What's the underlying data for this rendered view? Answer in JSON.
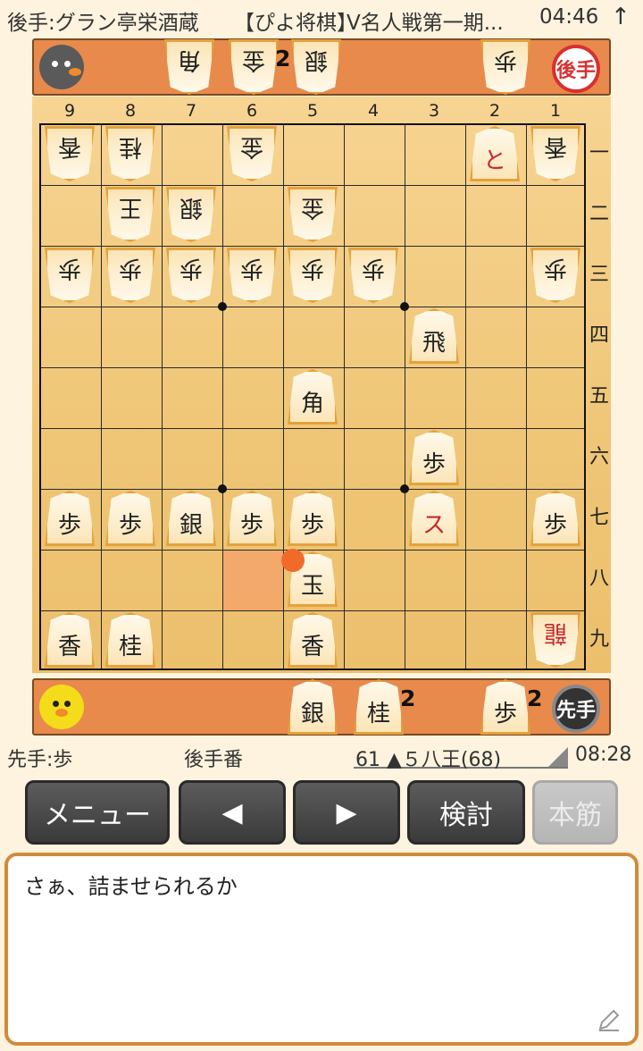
{
  "top_bar": {
    "opponent": "後手:グラン亭栄酒蔵",
    "app_name": "【ぴよ将棋】",
    "event": "V名人戦第一期...",
    "time": "04:46",
    "arrow": "↑"
  },
  "gote_hand": {
    "badge": "後手",
    "pieces": [
      {
        "label": "角",
        "count": ""
      },
      {
        "label": "金",
        "count": "2"
      },
      {
        "label": "銀",
        "count": ""
      },
      {
        "label": "歩",
        "count": ""
      }
    ]
  },
  "sente_hand": {
    "badge": "先手",
    "pieces": [
      {
        "label": "銀",
        "count": ""
      },
      {
        "label": "桂",
        "count": "2"
      },
      {
        "label": "歩",
        "count": "2"
      }
    ]
  },
  "board": {
    "files": [
      "9",
      "8",
      "7",
      "6",
      "5",
      "4",
      "3",
      "2",
      "1"
    ],
    "ranks": [
      "一",
      "二",
      "三",
      "四",
      "五",
      "六",
      "七",
      "八",
      "九"
    ],
    "pieces": [
      {
        "file": 9,
        "rank": 1,
        "label": "香",
        "owner": "gote"
      },
      {
        "file": 8,
        "rank": 1,
        "label": "桂",
        "owner": "gote"
      },
      {
        "file": 6,
        "rank": 1,
        "label": "金",
        "owner": "gote"
      },
      {
        "file": 2,
        "rank": 1,
        "label": "と",
        "owner": "sente",
        "promoted": true
      },
      {
        "file": 1,
        "rank": 1,
        "label": "香",
        "owner": "gote"
      },
      {
        "file": 8,
        "rank": 2,
        "label": "王",
        "owner": "gote"
      },
      {
        "file": 7,
        "rank": 2,
        "label": "銀",
        "owner": "gote"
      },
      {
        "file": 5,
        "rank": 2,
        "label": "金",
        "owner": "gote"
      },
      {
        "file": 9,
        "rank": 3,
        "label": "歩",
        "owner": "gote"
      },
      {
        "file": 8,
        "rank": 3,
        "label": "歩",
        "owner": "gote"
      },
      {
        "file": 7,
        "rank": 3,
        "label": "歩",
        "owner": "gote"
      },
      {
        "file": 6,
        "rank": 3,
        "label": "歩",
        "owner": "gote"
      },
      {
        "file": 5,
        "rank": 3,
        "label": "歩",
        "owner": "gote"
      },
      {
        "file": 4,
        "rank": 3,
        "label": "歩",
        "owner": "gote"
      },
      {
        "file": 1,
        "rank": 3,
        "label": "歩",
        "owner": "gote"
      },
      {
        "file": 3,
        "rank": 4,
        "label": "飛",
        "owner": "sente"
      },
      {
        "file": 5,
        "rank": 5,
        "label": "角",
        "owner": "sente"
      },
      {
        "file": 3,
        "rank": 6,
        "label": "歩",
        "owner": "sente"
      },
      {
        "file": 9,
        "rank": 7,
        "label": "歩",
        "owner": "sente"
      },
      {
        "file": 8,
        "rank": 7,
        "label": "歩",
        "owner": "sente"
      },
      {
        "file": 7,
        "rank": 7,
        "label": "銀",
        "owner": "sente"
      },
      {
        "file": 6,
        "rank": 7,
        "label": "歩",
        "owner": "sente"
      },
      {
        "file": 5,
        "rank": 7,
        "label": "歩",
        "owner": "sente"
      },
      {
        "file": 3,
        "rank": 7,
        "label": "ス",
        "owner": "sente",
        "promoted": true
      },
      {
        "file": 1,
        "rank": 7,
        "label": "歩",
        "owner": "sente"
      },
      {
        "file": 5,
        "rank": 8,
        "label": "玉",
        "owner": "sente"
      },
      {
        "file": 9,
        "rank": 9,
        "label": "香",
        "owner": "sente"
      },
      {
        "file": 8,
        "rank": 9,
        "label": "桂",
        "owner": "sente"
      },
      {
        "file": 5,
        "rank": 9,
        "label": "香",
        "owner": "sente"
      },
      {
        "file": 1,
        "rank": 9,
        "label": "龍",
        "owner": "gote",
        "promoted": true
      }
    ],
    "highlight_from": {
      "file": 6,
      "rank": 8
    },
    "last_move_to": {
      "file": 5,
      "rank": 8
    }
  },
  "status": {
    "sente_info": "先手:歩",
    "turn": "後手番",
    "move": "61 ▲５八王(68)",
    "clock": "08:28"
  },
  "buttons": {
    "menu": "メニュー",
    "prev": "◀",
    "next": "▶",
    "study": "検討",
    "mainline": "本筋"
  },
  "message": "さぁ、詰ませられるか",
  "colors": {
    "hand_bar": "#e88a4c",
    "board": "#f0c878",
    "accent_red": "#c8282a"
  }
}
